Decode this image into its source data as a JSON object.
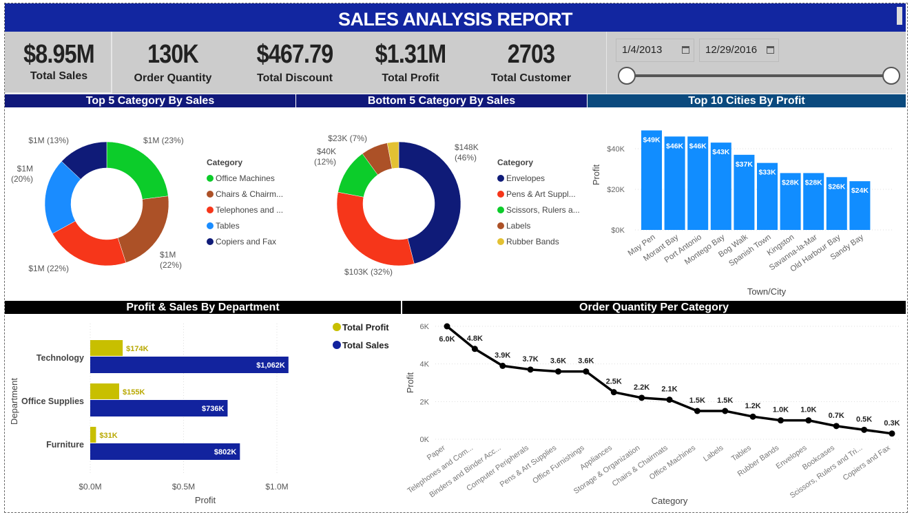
{
  "header": {
    "title": "SALES ANALYSIS REPORT"
  },
  "kpis": [
    {
      "value": "$8.95M",
      "label": "Total Sales"
    },
    {
      "value": "130K",
      "label": "Order Quantity"
    },
    {
      "value": "$467.79",
      "label": "Total Discount"
    },
    {
      "value": "$1.31M",
      "label": "Total Profit"
    },
    {
      "value": "2703",
      "label": "Total Customer"
    }
  ],
  "date_slicer": {
    "start": "1/4/2013",
    "end": "12/29/2016",
    "icon": "calendar-icon",
    "range_fraction": [
      0,
      1
    ]
  },
  "sections": {
    "top5": "Top 5 Category By Sales",
    "bottom5": "Bottom 5 Category By Sales",
    "cities": "Top 10 Cities By Profit",
    "dept": "Profit & Sales By Department",
    "orderqty": "Order Quantity Per Category"
  },
  "colors": {
    "title_bar": "#1226a0",
    "section_navy": "#10187a",
    "section_teal": "#0b4a7e",
    "bar_blue": "#118dff",
    "sales_navy": "#12239e",
    "profit_olive": "#c8bf00"
  },
  "chart_data": [
    {
      "type": "pie",
      "subtype": "donut",
      "legend_title": "Category",
      "legend": "right",
      "slices": [
        {
          "name": "Office Machines",
          "legend_label": "Office Machines",
          "label": "$1M (23%)",
          "percent": 23,
          "color": "#0ccc2a"
        },
        {
          "name": "Chairs & Chairmats",
          "legend_label": "Chairs & Chairm...",
          "label": "$1M (22%)",
          "percent": 22,
          "color": "#ac5127"
        },
        {
          "name": "Telephones and Communication",
          "legend_label": "Telephones and ...",
          "label": "$1M (22%)",
          "percent": 22,
          "color": "#f6361a"
        },
        {
          "name": "Tables",
          "legend_label": "Tables",
          "label": "$1M (20%)",
          "percent": 20,
          "color": "#1a8cff"
        },
        {
          "name": "Copiers and Fax",
          "legend_label": "Copiers and Fax",
          "label": "$1M (13%)",
          "percent": 13,
          "color": "#0f1b78"
        }
      ]
    },
    {
      "type": "pie",
      "subtype": "donut",
      "legend_title": "Category",
      "legend": "right",
      "slices": [
        {
          "name": "Envelopes",
          "legend_label": "Envelopes",
          "label": "$148K (46%)",
          "percent": 46,
          "color": "#0f1b78"
        },
        {
          "name": "Pens & Art Supplies",
          "legend_label": "Pens & Art Suppl...",
          "label": "$103K (32%)",
          "percent": 32,
          "color": "#f6361a"
        },
        {
          "name": "Scissors, Rulers and Trimmers",
          "legend_label": "Scissors, Rulers a...",
          "label": "$40K (12%)",
          "percent": 12,
          "color": "#0ccc2a"
        },
        {
          "name": "Labels",
          "legend_label": "Labels",
          "label": "$23K (7%)",
          "percent": 7,
          "color": "#ac5127"
        },
        {
          "name": "Rubber Bands",
          "legend_label": "Rubber Bands",
          "label": "",
          "percent": 3,
          "color": "#e3c133"
        }
      ]
    },
    {
      "type": "bar",
      "xlabel": "Town/City",
      "ylabel": "Profit",
      "ylim": [
        0,
        50000
      ],
      "yticks": [
        "$0K",
        "$20K",
        "$40K"
      ],
      "categories": [
        "May Pen",
        "Morant Bay",
        "Port Antonio",
        "Montego Bay",
        "Bog Walk",
        "Spanish Town",
        "Kingston",
        "Savanna-la-Mar",
        "Old Harbour Bay",
        "Sandy Bay"
      ],
      "values": [
        49000,
        46000,
        46000,
        43000,
        37000,
        33000,
        28000,
        28000,
        26000,
        24000
      ],
      "labels": [
        "$49K",
        "$46K",
        "$46K",
        "$43K",
        "$37K",
        "$33K",
        "$28K",
        "$28K",
        "$26K",
        "$24K"
      ]
    },
    {
      "type": "bar",
      "orientation": "horizontal",
      "xlabel": "Profit",
      "ylabel": "Department",
      "xlim": [
        0,
        1.1
      ],
      "xticks": [
        "$0.0M",
        "$0.5M",
        "$1.0M"
      ],
      "legend": "top-right",
      "categories": [
        "Technology",
        "Office Supplies",
        "Furniture"
      ],
      "series": [
        {
          "name": "Total Profit",
          "values": [
            0.174,
            0.155,
            0.031
          ],
          "labels": [
            "$174K",
            "$155K",
            "$31K"
          ]
        },
        {
          "name": "Total Sales",
          "values": [
            1.062,
            0.736,
            0.802
          ],
          "labels": [
            "$1,062K",
            "$736K",
            "$802K"
          ]
        }
      ]
    },
    {
      "type": "line",
      "xlabel": "Category",
      "ylabel": "Profit",
      "ylim": [
        0,
        6000
      ],
      "yticks": [
        "0K",
        "2K",
        "4K",
        "6K"
      ],
      "categories": [
        "Paper",
        "Telephones and Com...",
        "Binders and Binder Acc...",
        "Computer Peripherals",
        "Pens & Art Supplies",
        "Office Furnishings",
        "Appliances",
        "Storage & Organization",
        "Chairs & Chairmats",
        "Office Machines",
        "Labels",
        "Tables",
        "Rubber Bands",
        "Envelopes",
        "Bookcases",
        "Scissors, Rulers and Tri...",
        "Copiers and Fax"
      ],
      "values": [
        6000,
        4800,
        3900,
        3700,
        3600,
        3600,
        2500,
        2200,
        2100,
        1500,
        1500,
        1200,
        1000,
        1000,
        700,
        500,
        300
      ],
      "labels": [
        "6.0K",
        "4.8K",
        "3.9K",
        "3.7K",
        "3.6K",
        "3.6K",
        "2.5K",
        "2.2K",
        "2.1K",
        "1.5K",
        "1.5K",
        "1.2K",
        "1.0K",
        "1.0K",
        "0.7K",
        "0.5K",
        "0.3K"
      ]
    }
  ]
}
